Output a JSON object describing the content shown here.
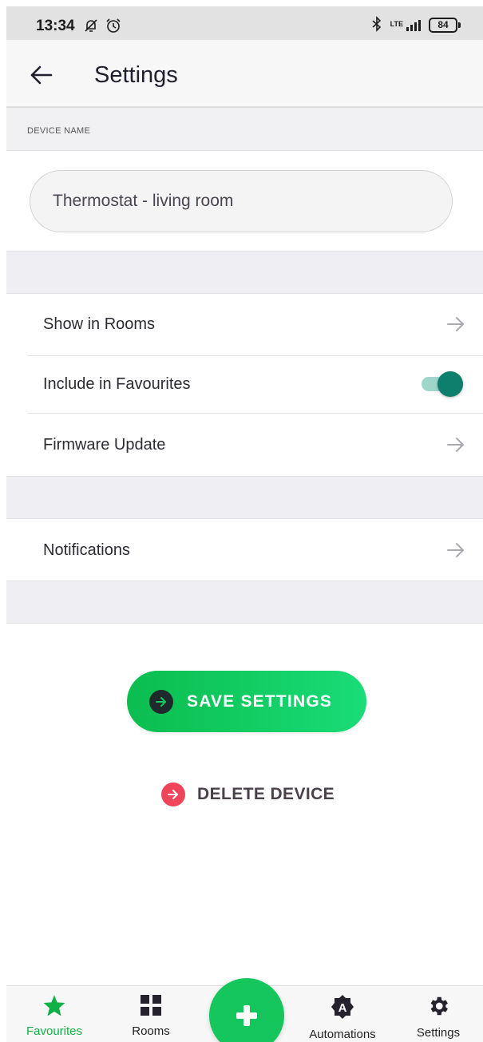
{
  "status_bar": {
    "time": "13:34",
    "network": "LTE",
    "battery": "84"
  },
  "header": {
    "title": "Settings"
  },
  "device_name_section": {
    "label": "DEVICE NAME",
    "value": "Thermostat - living room"
  },
  "settings_rows": [
    {
      "label": "Show in Rooms",
      "type": "arrow"
    },
    {
      "label": "Include in Favourites",
      "type": "toggle",
      "enabled": true
    },
    {
      "label": "Firmware Update",
      "type": "arrow"
    }
  ],
  "notifications_row": {
    "label": "Notifications"
  },
  "actions": {
    "save_label": "SAVE SETTINGS",
    "delete_label": "DELETE DEVICE"
  },
  "bottom_nav": {
    "items": [
      {
        "label": "Favourites",
        "icon": "star-icon",
        "active": true
      },
      {
        "label": "Rooms",
        "icon": "grid-icon",
        "active": false
      },
      {
        "label": "Automations",
        "icon": "automation-icon",
        "active": false
      },
      {
        "label": "Settings",
        "icon": "gear-icon",
        "active": false
      }
    ],
    "fab_icon": "plus-icon"
  },
  "colors": {
    "accent_green": "#12c65a",
    "toggle_teal": "#0e7f6d",
    "delete_red": "#f0445a",
    "active_nav": "#11b046"
  }
}
